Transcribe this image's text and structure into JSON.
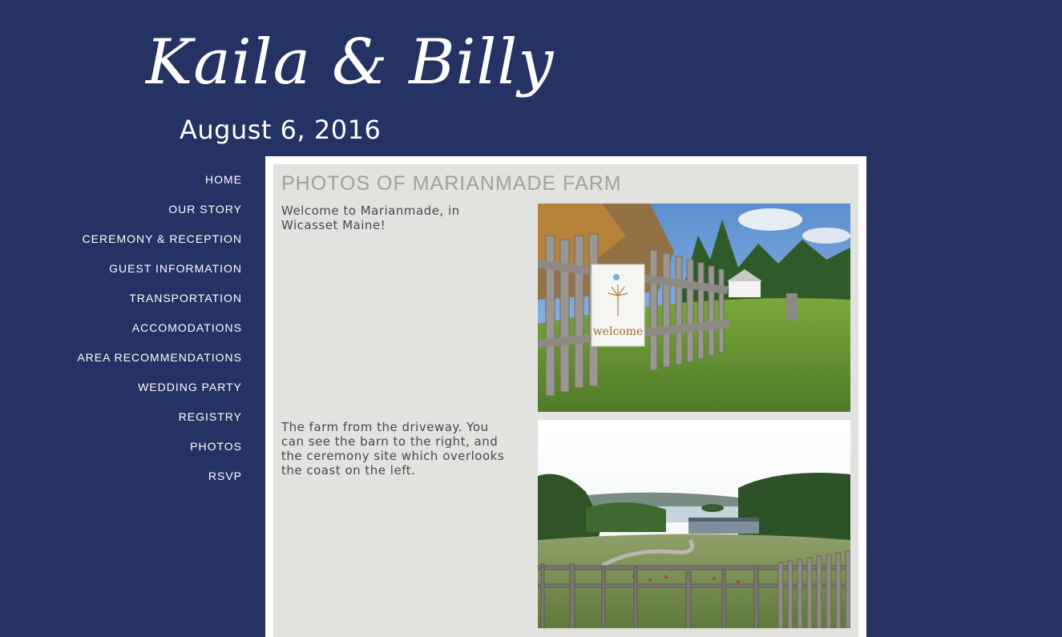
{
  "header": {
    "title": "Kaila & Billy",
    "date": "August 6, 2016"
  },
  "nav": {
    "items": [
      {
        "label": "HOME",
        "name": "home"
      },
      {
        "label": "OUR STORY",
        "name": "our-story"
      },
      {
        "label": "CEREMONY & RECEPTION",
        "name": "ceremony-reception"
      },
      {
        "label": "GUEST INFORMATION",
        "name": "guest-information"
      },
      {
        "label": "TRANSPORTATION",
        "name": "transportation"
      },
      {
        "label": "ACCOMODATIONS",
        "name": "accomodations"
      },
      {
        "label": "AREA RECOMMENDATIONS",
        "name": "area-recommendations"
      },
      {
        "label": "WEDDING PARTY",
        "name": "wedding-party"
      },
      {
        "label": "REGISTRY",
        "name": "registry"
      },
      {
        "label": "PHOTOS",
        "name": "photos"
      },
      {
        "label": "RSVP",
        "name": "rsvp"
      }
    ]
  },
  "main": {
    "heading": "PHOTOS OF MARIANMADE FARM",
    "photos": [
      {
        "caption": "Welcome to Marianmade, in Wicasset Maine!",
        "sign_text": "welcome"
      },
      {
        "caption": "The farm from the driveway. You can see the barn to the right, and the ceremony site which overlooks the coast on the left."
      }
    ]
  },
  "colors": {
    "page_bg": "#243264",
    "content_bg": "#e2e3de",
    "heading": "#a1a29c",
    "caption": "#444a54"
  }
}
